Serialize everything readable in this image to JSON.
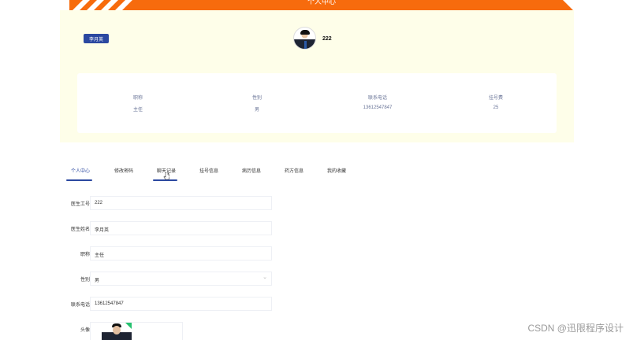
{
  "header": {
    "title": "个人中心"
  },
  "profile": {
    "name_badge": "李月英",
    "account": "222",
    "fields": [
      {
        "label": "职称",
        "value": "主任"
      },
      {
        "label": "性别",
        "value": "男"
      },
      {
        "label": "联系电话",
        "value": "13612547847"
      },
      {
        "label": "挂号费",
        "value": "25"
      }
    ]
  },
  "tabs": [
    {
      "label": "个人中心",
      "active": true
    },
    {
      "label": "修改密码",
      "active": false
    },
    {
      "label": "聊天记录",
      "active": false
    },
    {
      "label": "挂号信息",
      "active": false
    },
    {
      "label": "病历信息",
      "active": false
    },
    {
      "label": "药方信息",
      "active": false
    },
    {
      "label": "我的收藏",
      "active": false
    }
  ],
  "form": {
    "doctor_id": {
      "label": "医生工号",
      "value": "222"
    },
    "doctor_name": {
      "label": "医生姓名",
      "value": "李月英"
    },
    "title": {
      "label": "职称",
      "value": "主任"
    },
    "gender": {
      "label": "性别",
      "value": "男"
    },
    "phone": {
      "label": "联系电话",
      "value": "13612547847"
    },
    "avatar": {
      "label": "头像"
    }
  },
  "watermark": "CSDN @迅限程序设计",
  "colors": {
    "banner": "#f76b0d",
    "accent": "#2b48a0",
    "profile_bg": "#fefee9"
  }
}
